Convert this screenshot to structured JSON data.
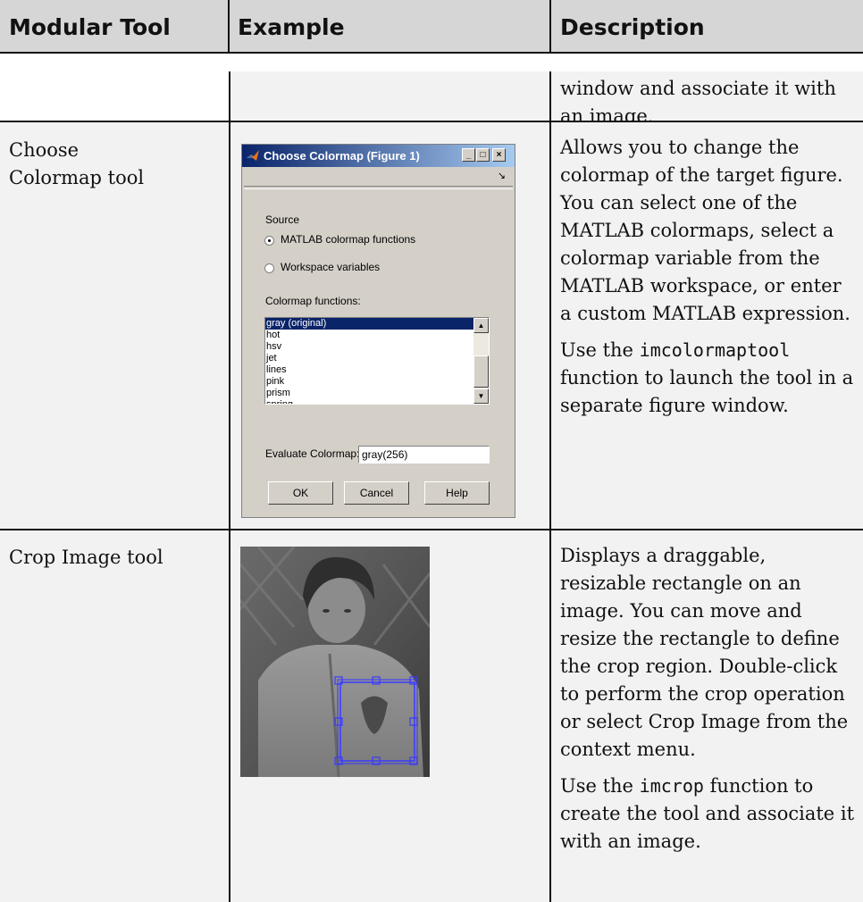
{
  "header": {
    "col1": "Modular Tool",
    "col2": "Example",
    "col3": "Description"
  },
  "rows": [
    {
      "tool": "",
      "description": [
        "window and associate it with an image."
      ]
    },
    {
      "tool": "Choose Colormap tool",
      "description_p1": "Allows you to change the colormap of the target figure. You can select one of the MATLAB colormaps, select a colormap variable from the MATLAB workspace, or enter a custom MATLAB expression.",
      "description_p2_pre": "Use the ",
      "description_p2_code": "imcolormaptool",
      "description_p2_post": " function to launch the tool in a separate figure window."
    },
    {
      "tool": "Crop Image tool",
      "description_p1": "Displays a draggable, resizable rectangle on an image. You can move and resize the rectangle to define the crop region. Double-click to perform the crop operation or select Crop Image from the context menu.",
      "description_p2_pre": "Use the ",
      "description_p2_code": "imcrop",
      "description_p2_post": " function to create the tool and associate it with an image."
    }
  ],
  "dialog": {
    "title": "Choose Colormap (Figure 1)",
    "source_label": "Source",
    "radio1": "MATLAB colormap functions",
    "radio2": "Workspace variables",
    "functions_label": "Colormap functions:",
    "list_items": [
      "gray (original)",
      "hot",
      "hsv",
      "jet",
      "lines",
      "pink",
      "prism",
      "spring"
    ],
    "selected_item": "gray (original)",
    "evaluate_label": "Evaluate Colormap:",
    "evaluate_value": "gray(256)",
    "ok": "OK",
    "cancel": "Cancel",
    "help": "Help",
    "minimize_glyph": "_",
    "maximize_glyph": "□",
    "close_glyph": "×",
    "scroll_up_glyph": "▲",
    "scroll_down_glyph": "▼",
    "expand_glyph": "↘"
  }
}
